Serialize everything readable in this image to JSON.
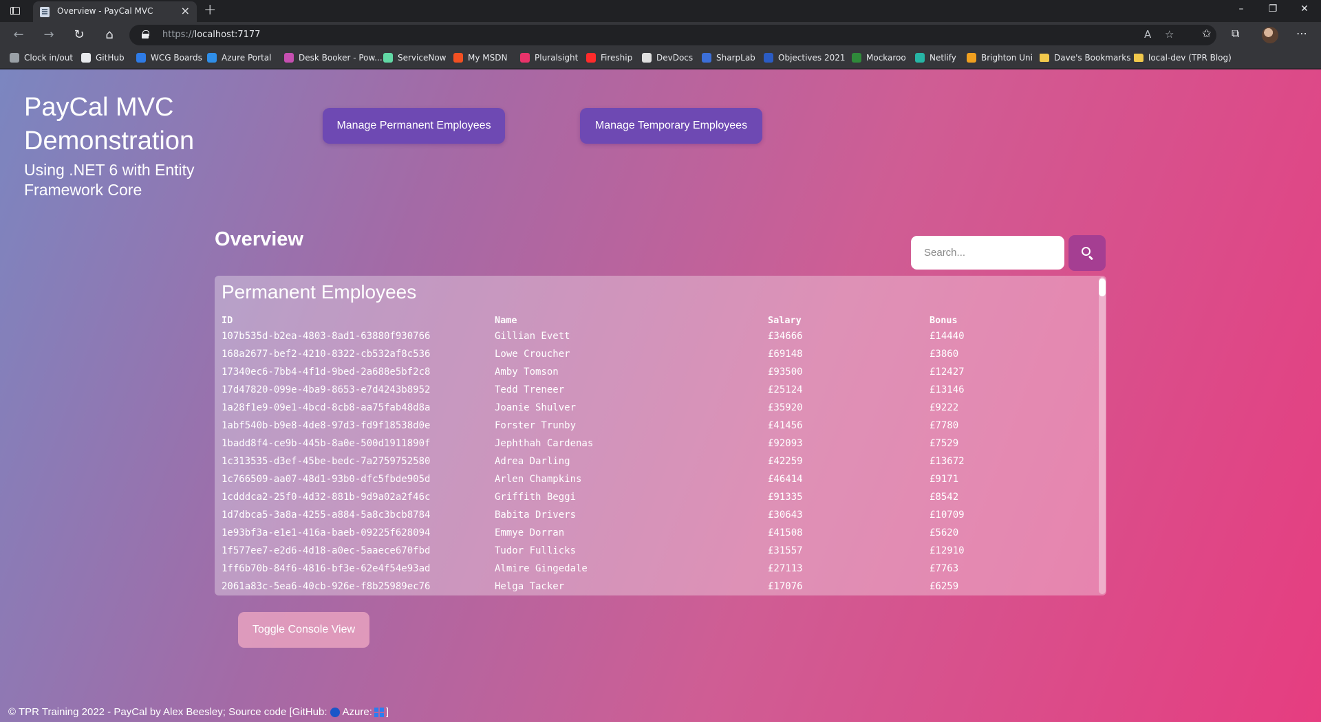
{
  "browser": {
    "tab_title": "Overview - PayCal MVC",
    "url_scheme": "https://",
    "url_host": "localhost:7177",
    "bookmarks": [
      {
        "label": "Clock in/out",
        "icon": "clock-icon",
        "color": "#9aa0a6"
      },
      {
        "label": "GitHub",
        "icon": "github-icon",
        "color": "#e8eaed"
      },
      {
        "label": "WCG Boards",
        "icon": "azure-boards-icon",
        "color": "#2e7be6"
      },
      {
        "label": "Azure Portal",
        "icon": "azure-icon",
        "color": "#2f8ee8"
      },
      {
        "label": "Desk Booker - Pow...",
        "icon": "powerapps-icon",
        "color": "#c54fb0"
      },
      {
        "label": "ServiceNow",
        "icon": "servicenow-icon",
        "color": "#62d8a5"
      },
      {
        "label": "My MSDN",
        "icon": "microsoft-icon",
        "color": "#f25022"
      },
      {
        "label": "Pluralsight",
        "icon": "pluralsight-icon",
        "color": "#e8336a"
      },
      {
        "label": "Fireship",
        "icon": "youtube-icon",
        "color": "#ff2b2b"
      },
      {
        "label": "DevDocs",
        "icon": "devdocs-icon",
        "color": "#e0e0e0"
      },
      {
        "label": "SharpLab",
        "icon": "sharplab-icon",
        "color": "#3c6fd8"
      },
      {
        "label": "Objectives 2021",
        "icon": "word-icon",
        "color": "#2b5cc4"
      },
      {
        "label": "Mockaroo",
        "icon": "mockaroo-icon",
        "color": "#2f8a3a"
      },
      {
        "label": "Netlify",
        "icon": "netlify-icon",
        "color": "#27b5a5"
      },
      {
        "label": "Brighton Uni",
        "icon": "brighton-icon",
        "color": "#f0a020"
      },
      {
        "label": "Dave's Bookmarks",
        "icon": "folder-icon",
        "color": "#f2c94c"
      },
      {
        "label": "local-dev (TPR Blog)",
        "icon": "folder-icon",
        "color": "#f2c94c"
      }
    ]
  },
  "page": {
    "site_title": "PayCal MVC Demonstration",
    "site_subtitle": "Using .NET 6 with Entity Framework Core",
    "btn_permanent": "Manage Permanent Employees",
    "btn_temporary": "Manage Temporary Employees",
    "heading": "Overview",
    "search_placeholder": "Search...",
    "panel_title": "Permanent Employees",
    "columns": [
      "ID",
      "Name",
      "Salary",
      "Bonus"
    ],
    "rows": [
      [
        "107b535d-b2ea-4803-8ad1-63880f930766",
        "Gillian Evett",
        "£34666",
        "£14440"
      ],
      [
        "168a2677-bef2-4210-8322-cb532af8c536",
        "Lowe Croucher",
        "£69148",
        "£3860"
      ],
      [
        "17340ec6-7bb4-4f1d-9bed-2a688e5bf2c8",
        "Amby Tomson",
        "£93500",
        "£12427"
      ],
      [
        "17d47820-099e-4ba9-8653-e7d4243b8952",
        "Tedd Treneer",
        "£25124",
        "£13146"
      ],
      [
        "1a28f1e9-09e1-4bcd-8cb8-aa75fab48d8a",
        "Joanie Shulver",
        "£35920",
        "£9222"
      ],
      [
        "1abf540b-b9e8-4de8-97d3-fd9f18538d0e",
        "Forster Trunby",
        "£41456",
        "£7780"
      ],
      [
        "1badd8f4-ce9b-445b-8a0e-500d1911890f",
        "Jephthah Cardenas",
        "£92093",
        "£7529"
      ],
      [
        "1c313535-d3ef-45be-bedc-7a2759752580",
        "Adrea Darling",
        "£42259",
        "£13672"
      ],
      [
        "1c766509-aa07-48d1-93b0-dfc5fbde905d",
        "Arlen Champkins",
        "£46414",
        "£9171"
      ],
      [
        "1cdddca2-25f0-4d32-881b-9d9a02a2f46c",
        "Griffith Beggi",
        "£91335",
        "£8542"
      ],
      [
        "1d7dbca5-3a8a-4255-a884-5a8c3bcb8784",
        "Babita Drivers",
        "£30643",
        "£10709"
      ],
      [
        "1e93bf3a-e1e1-416a-baeb-09225f628094",
        "Emmye Dorran",
        "£41508",
        "£5620"
      ],
      [
        "1f577ee7-e2d6-4d18-a0ec-5aaece670fbd",
        "Tudor Fullicks",
        "£31557",
        "£12910"
      ],
      [
        "1ff6b70b-84f6-4816-bf3e-62e4f54e93ad",
        "Almire Gingedale",
        "£27113",
        "£7763"
      ],
      [
        "2061a83c-5ea6-40cb-926e-f8b25989ec76",
        "Helga Tacker",
        "£17076",
        "£6259"
      ]
    ],
    "btn_console": "Toggle Console View",
    "footer_text": "© TPR Training 2022 - PayCal by Alex Beesley; Source code [GitHub:",
    "footer_azure": "Azure:",
    "footer_end": "]"
  },
  "colors": {
    "primary_button": "#6e49b3",
    "search_button": "#a53e92",
    "gradient_start": "#7b86c0",
    "gradient_end": "#e63d80"
  }
}
